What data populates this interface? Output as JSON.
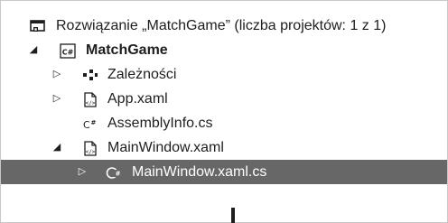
{
  "solution_explorer": {
    "solution": {
      "label": "Rozwiązanie „MatchGame” (liczba projektów: 1 z 1)",
      "icon": "solution-icon"
    },
    "project": {
      "label": "MatchGame",
      "icon": "csharp-project-icon",
      "expanded": true
    },
    "items": [
      {
        "label": "Zależności",
        "icon": "dependencies-icon",
        "expander": "collapsed"
      },
      {
        "label": "App.xaml",
        "icon": "xaml-file-icon",
        "expander": "collapsed"
      },
      {
        "label": "AssemblyInfo.cs",
        "icon": "csharp-file-icon",
        "expander": "none"
      },
      {
        "label": "MainWindow.xaml",
        "icon": "xaml-file-icon",
        "expander": "expanded"
      }
    ],
    "child": {
      "label": "MainWindow.xaml.cs",
      "icon": "csharp-class-icon",
      "expander": "collapsed",
      "selected": true
    }
  },
  "colors": {
    "selection_background": "#676767",
    "selection_text": "#ffffff",
    "text": "#1e1e1e",
    "border": "#c8c8c8"
  }
}
